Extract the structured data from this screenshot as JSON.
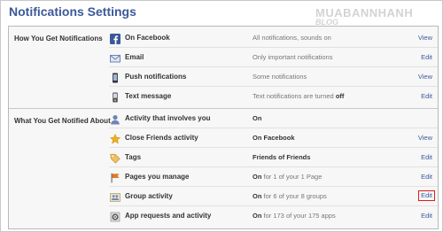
{
  "page": {
    "title": "Notifications Settings"
  },
  "watermark": {
    "line1": "MUABANNHANH",
    "line2": "BLOG"
  },
  "sections": [
    {
      "label": "How You Get Notifications",
      "rows": [
        {
          "icon": "facebook-icon",
          "label": "On Facebook",
          "status": "All notifications, sounds on",
          "status_bold": "",
          "status_rest": "",
          "action": "View"
        },
        {
          "icon": "email-icon",
          "label": "Email",
          "status": "Only important notifications",
          "status_bold": "",
          "status_rest": "",
          "action": "Edit"
        },
        {
          "icon": "phone-icon",
          "label": "Push notifications",
          "status": "Some notifications",
          "status_bold": "",
          "status_rest": "",
          "action": "View"
        },
        {
          "icon": "mobile-icon",
          "label": "Text message",
          "status": "Text notifications are turned ",
          "status_bold": "off",
          "status_rest": "",
          "action": "Edit"
        }
      ]
    },
    {
      "label": "What You Get Notified About",
      "rows": [
        {
          "icon": "person-icon",
          "label": "Activity that involves you",
          "status": "",
          "status_bold": "On",
          "status_rest": "",
          "action": ""
        },
        {
          "icon": "star-icon",
          "label": "Close Friends activity",
          "status": "",
          "status_bold": "On Facebook",
          "status_rest": "",
          "action": "View"
        },
        {
          "icon": "tag-icon",
          "label": "Tags",
          "status": "",
          "status_bold": "Friends of Friends",
          "status_rest": "",
          "action": "Edit"
        },
        {
          "icon": "flag-icon",
          "label": "Pages you manage",
          "status": "",
          "status_bold": "On",
          "status_rest": " for 1 of your 1 Page",
          "action": "Edit"
        },
        {
          "icon": "group-icon",
          "label": "Group activity",
          "status": "",
          "status_bold": "On",
          "status_rest": " for 6 of your 8 groups",
          "action": "Edit"
        },
        {
          "icon": "apps-icon",
          "label": "App requests and activity",
          "status": "",
          "status_bold": "On",
          "status_rest": " for 173 of your 175 apps",
          "action": "Edit"
        }
      ]
    }
  ],
  "colors": {
    "link": "#3b5998",
    "highlight": "#e01b1b"
  }
}
